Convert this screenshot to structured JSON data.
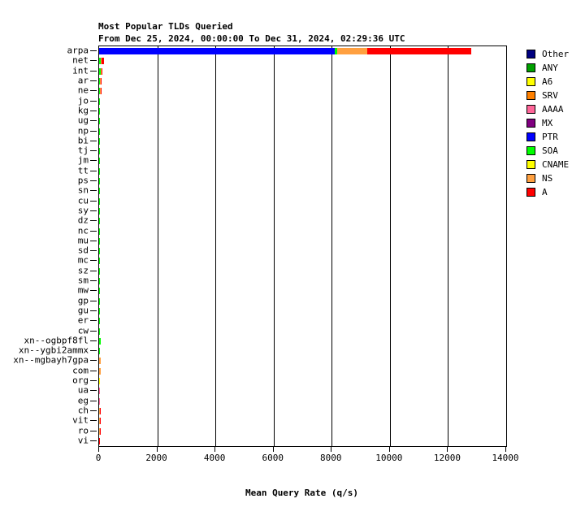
{
  "chart_data": {
    "type": "bar",
    "orientation": "horizontal",
    "title": "Most Popular TLDs Queried",
    "subtitle": "From Dec 25, 2024, 00:00:00 To Dec 31, 2024, 02:29:36 UTC",
    "xlabel": "Mean Query Rate (q/s)",
    "ylabel": "",
    "xlim": [
      0,
      14000
    ],
    "xticks": [
      0,
      2000,
      4000,
      6000,
      8000,
      10000,
      12000,
      14000
    ],
    "xticklabels": [
      "0",
      "2000",
      "4000",
      "6000",
      "8000",
      "10000",
      "12000",
      "14000"
    ],
    "grid": true,
    "legend_position": "right",
    "stacked": true,
    "categories": [
      "arpa",
      "net",
      "int",
      "ar",
      "ne",
      "jo",
      "kg",
      "ug",
      "np",
      "bi",
      "tj",
      "jm",
      "tt",
      "ps",
      "sn",
      "cu",
      "sy",
      "dz",
      "nc",
      "mu",
      "sd",
      "mc",
      "sz",
      "sm",
      "mw",
      "gp",
      "gu",
      "er",
      "cw",
      "xn--ogbpf8fl",
      "xn--ygbi2ammx",
      "xn--mgbayh7gpa",
      "com",
      "org",
      "ua",
      "eg",
      "ch",
      "vit",
      "ro",
      "vi"
    ],
    "series": [
      {
        "name": "Other",
        "color": "#000080",
        "values": [
          0,
          0,
          0,
          0,
          0,
          0,
          0,
          0,
          0,
          0,
          0,
          0,
          0,
          0,
          0,
          0,
          0,
          0,
          0,
          0,
          0,
          0,
          0,
          0,
          0,
          0,
          0,
          0,
          0,
          0,
          0,
          0,
          0,
          0,
          0,
          0,
          0,
          0,
          0,
          0
        ]
      },
      {
        "name": "ANY",
        "color": "#00A000",
        "values": [
          0,
          0,
          0,
          0,
          0,
          0,
          0,
          0,
          0,
          0,
          0,
          0,
          0,
          0,
          0,
          0,
          0,
          0,
          0,
          0,
          0,
          0,
          0,
          0,
          0,
          0,
          0,
          0,
          0,
          0,
          0,
          0,
          0,
          0,
          0,
          0,
          0,
          0,
          0,
          0
        ]
      },
      {
        "name": "A6",
        "color": "#FFFF00",
        "values": [
          0,
          0,
          0,
          0,
          0,
          0,
          0,
          0,
          0,
          0,
          0,
          0,
          0,
          0,
          0,
          0,
          0,
          0,
          0,
          0,
          0,
          0,
          0,
          0,
          0,
          0,
          0,
          0,
          0,
          0,
          0,
          0,
          0,
          0,
          0,
          0,
          0,
          0,
          0,
          0
        ]
      },
      {
        "name": "SRV",
        "color": "#FF8000",
        "values": [
          0,
          0,
          0,
          0,
          0,
          0,
          0,
          0,
          0,
          0,
          0,
          0,
          0,
          0,
          0,
          0,
          0,
          0,
          0,
          0,
          0,
          0,
          0,
          0,
          0,
          0,
          0,
          0,
          0,
          0,
          0,
          0,
          0,
          0,
          0,
          0,
          0,
          0,
          0,
          0
        ]
      },
      {
        "name": "AAAA",
        "color": "#FF6699",
        "values": [
          0,
          0,
          0,
          0,
          0,
          0,
          0,
          0,
          0,
          0,
          0,
          0,
          0,
          0,
          0,
          0,
          0,
          0,
          0,
          0,
          0,
          0,
          0,
          0,
          0,
          0,
          0,
          0,
          0,
          0,
          0,
          0,
          0,
          0,
          28,
          28,
          0,
          0,
          0,
          0
        ]
      },
      {
        "name": "MX",
        "color": "#800080",
        "values": [
          0,
          0,
          0,
          0,
          0,
          0,
          0,
          0,
          0,
          0,
          0,
          0,
          0,
          0,
          0,
          0,
          0,
          0,
          0,
          0,
          0,
          0,
          0,
          0,
          0,
          0,
          0,
          0,
          0,
          0,
          0,
          0,
          0,
          0,
          0,
          0,
          0,
          0,
          0,
          0
        ]
      },
      {
        "name": "PTR",
        "color": "#0000FF",
        "values": [
          8100,
          0,
          0,
          0,
          0,
          0,
          0,
          0,
          0,
          0,
          0,
          0,
          0,
          0,
          0,
          0,
          0,
          0,
          0,
          0,
          0,
          0,
          0,
          0,
          0,
          0,
          0,
          0,
          0,
          0,
          0,
          0,
          0,
          0,
          0,
          0,
          0,
          0,
          0,
          0
        ]
      },
      {
        "name": "SOA",
        "color": "#00FF00",
        "values": [
          85,
          56,
          42,
          36,
          30,
          30,
          30,
          30,
          30,
          30,
          28,
          28,
          28,
          28,
          28,
          28,
          28,
          28,
          28,
          28,
          28,
          28,
          28,
          28,
          28,
          28,
          28,
          28,
          28,
          56,
          34,
          0,
          0,
          0,
          0,
          0,
          0,
          0,
          0,
          0
        ]
      },
      {
        "name": "CNAME",
        "color": "#FFFF00",
        "values": [
          0,
          0,
          0,
          0,
          0,
          0,
          0,
          0,
          0,
          0,
          0,
          0,
          0,
          0,
          0,
          0,
          0,
          0,
          0,
          0,
          0,
          0,
          0,
          0,
          0,
          0,
          0,
          0,
          0,
          0,
          0,
          0,
          0,
          40,
          0,
          0,
          0,
          0,
          0,
          0
        ]
      },
      {
        "name": "NS",
        "color": "#FFA040",
        "values": [
          1050,
          14,
          28,
          14,
          14,
          0,
          0,
          0,
          0,
          0,
          0,
          0,
          0,
          0,
          0,
          0,
          0,
          0,
          0,
          0,
          0,
          0,
          0,
          0,
          0,
          0,
          0,
          0,
          0,
          0,
          0,
          56,
          42,
          0,
          0,
          0,
          28,
          28,
          28,
          0
        ]
      },
      {
        "name": "A",
        "color": "#FF0000",
        "values": [
          3560,
          84,
          28,
          42,
          28,
          0,
          0,
          0,
          0,
          0,
          0,
          0,
          0,
          0,
          0,
          0,
          0,
          0,
          0,
          0,
          0,
          0,
          0,
          0,
          0,
          0,
          0,
          0,
          0,
          0,
          0,
          0,
          0,
          0,
          0,
          0,
          28,
          28,
          28,
          28
        ]
      }
    ],
    "totals": [
      12795,
      154,
      98,
      92,
      72,
      30,
      30,
      30,
      30,
      30,
      28,
      28,
      28,
      28,
      28,
      28,
      28,
      28,
      28,
      28,
      28,
      28,
      28,
      28,
      28,
      28,
      28,
      28,
      28,
      56,
      34,
      56,
      42,
      40,
      28,
      28,
      56,
      56,
      56,
      28
    ]
  },
  "legend": {
    "items": [
      {
        "label": "Other",
        "color": "#000080"
      },
      {
        "label": "ANY",
        "color": "#00A000"
      },
      {
        "label": "A6",
        "color": "#FFFF00"
      },
      {
        "label": "SRV",
        "color": "#FF8000"
      },
      {
        "label": "AAAA",
        "color": "#FF6699"
      },
      {
        "label": "MX",
        "color": "#800080"
      },
      {
        "label": "PTR",
        "color": "#0000FF"
      },
      {
        "label": "SOA",
        "color": "#00FF00"
      },
      {
        "label": "CNAME",
        "color": "#FFFF00"
      },
      {
        "label": "NS",
        "color": "#FFA040"
      },
      {
        "label": "A",
        "color": "#FF0000"
      }
    ]
  }
}
